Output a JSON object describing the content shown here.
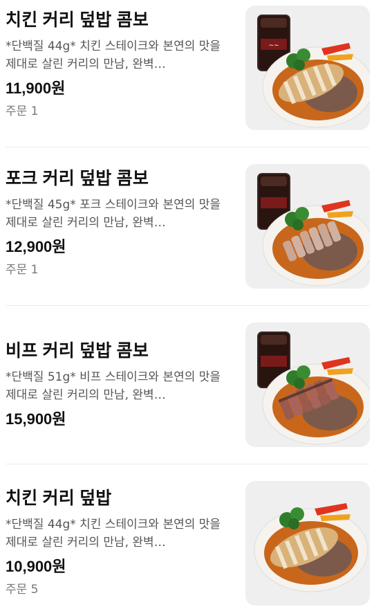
{
  "menu_items": [
    {
      "name": "치킨 커리 덮밥 콤보",
      "description": "*단백질 44g* 치킨 스테이크와 본연의 맛을 제대로 살린 커리의 만남, 완벽…",
      "price": "11,900원",
      "orders": "주문 1",
      "image": "chicken-curry-rice-with-cola-image",
      "meat_color": "#d9b27a"
    },
    {
      "name": "포크 커리 덮밥 콤보",
      "description": "*단백질 45g* 포크 스테이크와 본연의 맛을 제대로 살린 커리의 만남, 완벽…",
      "price": "12,900원",
      "orders": "주문 1",
      "image": "pork-curry-rice-with-cola-image",
      "meat_color": "#caa795"
    },
    {
      "name": "비프 커리 덮밥 콤보",
      "description": "*단백질 51g* 비프 스테이크와 본연의 맛을 제대로 살린 커리의 만남, 완벽…",
      "price": "15,900원",
      "orders": "",
      "image": "beef-curry-rice-with-cola-image",
      "meat_color": "#9a5a4e"
    },
    {
      "name": "치킨 커리 덮밥",
      "description": "*단백질 44g* 치킨 스테이크와 본연의 맛을 제대로 살린 커리의 만남, 완벽…",
      "price": "10,900원",
      "orders": "주문 5",
      "image": "chicken-curry-rice-image",
      "meat_color": "#d9b27a"
    }
  ]
}
